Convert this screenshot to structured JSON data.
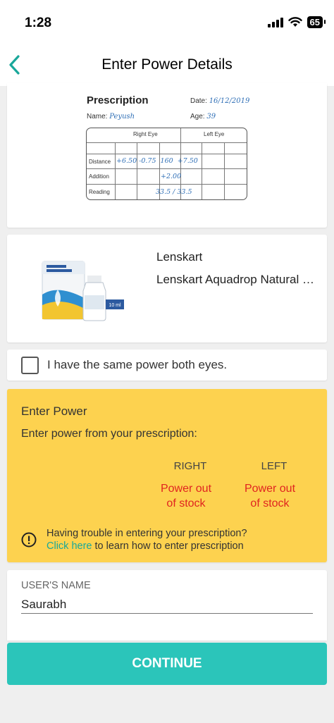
{
  "status_bar": {
    "time": "1:28",
    "battery": "65"
  },
  "header": {
    "title": "Enter Power Details",
    "back_icon": "chevron-left-icon"
  },
  "prescription": {
    "title": "Prescription",
    "name_label": "Name:",
    "name_value": "Peyush",
    "date_label": "Date:",
    "date_value": "16/12/2019",
    "age_label": "Age:",
    "age_value": "39",
    "right_eye_label": "Right Eye",
    "left_eye_label": "Left Eye",
    "rows": [
      {
        "label": "Distance",
        "value": "+6.50 -0.75  160  +7.50"
      },
      {
        "label": "Addition",
        "value": "+2.00"
      },
      {
        "label": "Reading",
        "value": "33.5 / 33.5"
      }
    ]
  },
  "product": {
    "brand": "Lenskart",
    "name": "Lenskart Aquadrop Natural Lubricant Eye Drops",
    "image_label": "10 ml"
  },
  "same_power": {
    "label": "I have the same power both eyes.",
    "checked": false
  },
  "enter_power": {
    "title": "Enter Power",
    "subtitle": "Enter power from your prescription:",
    "right_label": "RIGHT",
    "left_label": "LEFT",
    "right_status_line1": "Power out",
    "right_status_line2": "of stock",
    "left_status_line1": "Power out",
    "left_status_line2": "of stock",
    "help_text": "Having trouble in entering your prescription?",
    "help_link": "Click here",
    "help_suffix": "to learn how to enter prescription"
  },
  "user": {
    "label": "USER'S NAME",
    "value": "Saurabh"
  },
  "continue_label": "CONTINUE",
  "colors": {
    "accent": "#2bc5ba",
    "panel": "#fdd24f",
    "error": "#e02420",
    "link": "#19a79a"
  }
}
